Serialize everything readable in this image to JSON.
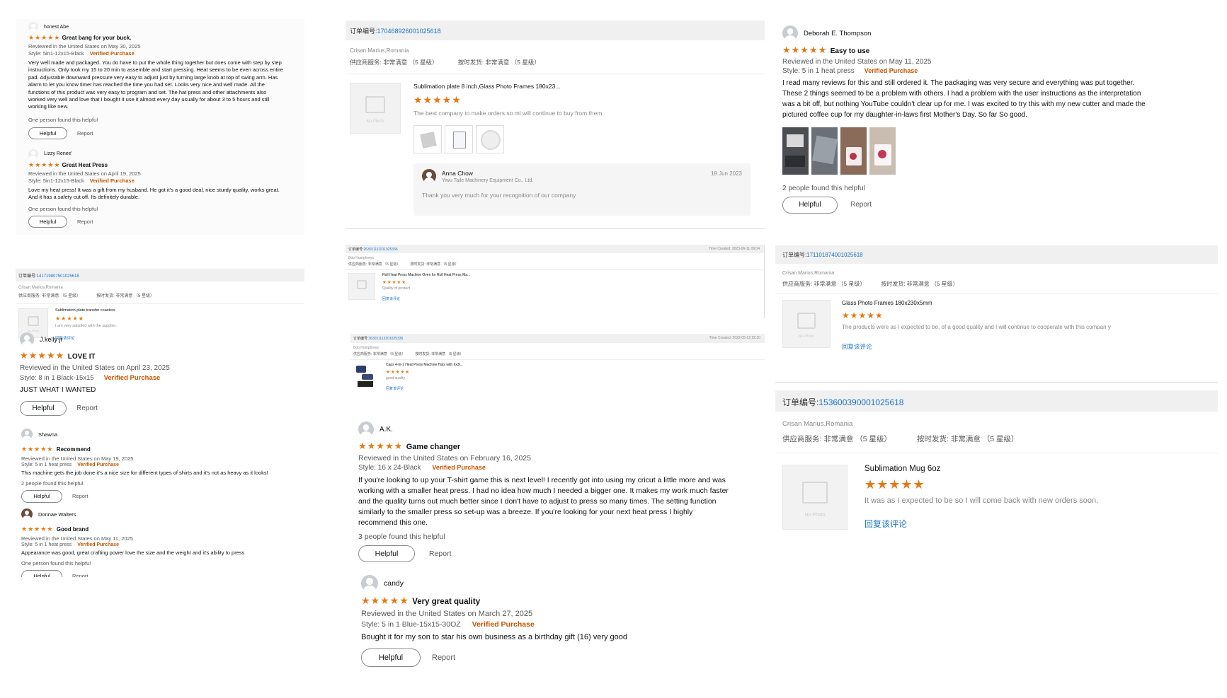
{
  "amazon": {
    "helpful_label": "Helpful",
    "report_label": "Report",
    "verified_label": "Verified Purchase",
    "stars": "★★★★★",
    "reviews": [
      {
        "name": "honest Abe",
        "title": "Great bang for your buck.",
        "date": "Reviewed in the United States on May 30, 2025",
        "style": "Style: 5in1-12x15-Black",
        "body": "Very well made and packaged. You do have to put the whole thing together but does come with step by step instructions. Only took my 15 to 20 min to assemble and start pressing. Heat seems to be even across entire pad. Adjustable downward pressure very easy to adjust just by turning large knob at top of swing arm. Has alarm to let you know timer has reached the time you had set. Looks very nice and well made. All the functions of this product was very easy to program and set. The hat press and other attachments also worked very well and love that I bought it use it almost every day usually for about 3 to 5 hours and still working like new.",
        "helpful": "One person found this helpful"
      },
      {
        "name": "Lizzy Renee'",
        "title": "Great Heat Press",
        "date": "Reviewed in the United States on April 19, 2025",
        "style": "Style: 5in1-12x15-Black",
        "body": "Love my heat press! It was a gift from my husband. He got it's a good deal, nice sturdy quality, works great. And it has a safety cut off. Its definitely durable.",
        "helpful": "One person found this helpful"
      },
      {
        "name": "J.kelly jr",
        "title": "LOVE IT",
        "date": "Reviewed in the United States on April 23, 2025",
        "style": "Style: 8 in 1 Black-15x15",
        "body": "JUST WHAT I WANTED",
        "helpful": ""
      },
      {
        "name": "Shawna",
        "title": "Recommend",
        "date": "Reviewed in the United States on May 19, 2025",
        "style": "Style: 5 in 1 heat press",
        "body": "This machine gets the job done it's a nice size for different types of shirts and it's not as heavy as it looks!",
        "helpful": "2 people found this helpful"
      },
      {
        "name": "Donnae Walters",
        "title": "Good brand",
        "date": "Reviewed in the United States on May 11, 2025",
        "style": "Style: 5 in 1 heat press",
        "body": "Appearance was good, great crafting power love the size and the weight and it's ability to press",
        "helpful": "One person found this helpful"
      },
      {
        "name": "A.K.",
        "title": "Game changer",
        "date": "Reviewed in the United States on February 16, 2025",
        "style": "Style: 16 x 24-Black",
        "body": "If you're looking to up your T-shirt game this is next level! I recently got into using my cricut a little more and was working with a smaller heat press. I had no idea how much I needed a bigger one. It makes my work much faster and the quality turns out much better since I don't have to adjust to press so many times. The setting function similarly to the smaller press so set-up was a breeze. If you're looking for your next heat press I highly recommend this one.",
        "helpful": "3 people found this helpful"
      },
      {
        "name": "candy",
        "title": "Very great quality",
        "date": "Reviewed in the United States on March 27, 2025",
        "style": "Style: 5 in 1 Blue-15x15-30OZ",
        "body": "Bought it for my son to star his own business as a birthday gift (16) very good",
        "helpful": ""
      },
      {
        "name": "Deborah E. Thompson",
        "title": "Easy to use",
        "date": "Reviewed in the United States on May 11, 2025",
        "style": "Style: 5 in 1 heat press",
        "body": "I read many reviews for this and still ordered it. The packaging was very secure and everything was put together. These 2 things seemed to be a problem with others. I had a problem with the user instructions as the interpretation was a bit off, but nothing YouTube couldn't clear up for me. I was excited to try this with my new cutter and made the pictured coffee cup for my daughter-in-laws first Mother's Day. So far So good.",
        "helpful": "2 people found this helpful"
      }
    ]
  },
  "ali": {
    "order_label": "订单编号:",
    "supplier": "供应商服务: 非常满意 （5 星级）",
    "shipping": "按时发货: 非常满意 （5 星级）",
    "reply_link": "回复该评论",
    "no_photo": "No Photo",
    "stars": "★★★★★",
    "orders": [
      {
        "number": "170468926001025618",
        "buyer": "Crisan Marius,Romania",
        "product": "Sublimation plate 8 inch,Glass Photo Frames 180x23...",
        "comment": "The best company to make orders so ml will continue to buy from them.",
        "reply_name": "Anna Chow",
        "reply_company": "Yiwu Taile Machinery Equipment Co., Ltd.",
        "reply_date": "19 Jun 2023",
        "reply_text": "Thank you very much for your recognition of our company"
      },
      {
        "number": "141719807501025618",
        "buyer": "Crisan Marius,Romania",
        "product": "Sublimation plate,transfer coasters",
        "comment": "I am very satisfied with the supplier."
      },
      {
        "number": "263011111101025336",
        "buyer": "Bob Humphreys",
        "time": "Time Created: 2023-06-11 09:04",
        "product": "Roll Heat Press Machine Oven for Roll Heat Press Ma...",
        "comment": "Quality of product"
      },
      {
        "number": "263011113301025336",
        "buyer": "Bob Humphreys",
        "time": "Time Created: 2022-05-12 22:10",
        "product": "Caps 4-in-1 Heat Press Machine Hats with 6x3l...",
        "comment": "good quality"
      },
      {
        "number": "171101874001025618",
        "buyer": "Crisan Marius,Romania",
        "product": "Glass Photo Frames 180x230x5mm",
        "comment": "The products were as I expected to be, of a good quality and I will continue to cooperate with this compan y"
      },
      {
        "number": "153600390001025618",
        "buyer": "Crisan Marius,Romania",
        "product": "Sublimation Mug 6oz",
        "comment": "It was as I expected to be so I will come back with new orders soon."
      }
    ]
  },
  "colors": {
    "star": "#e47911",
    "verified": "#c45500",
    "link": "#1a73c6"
  }
}
